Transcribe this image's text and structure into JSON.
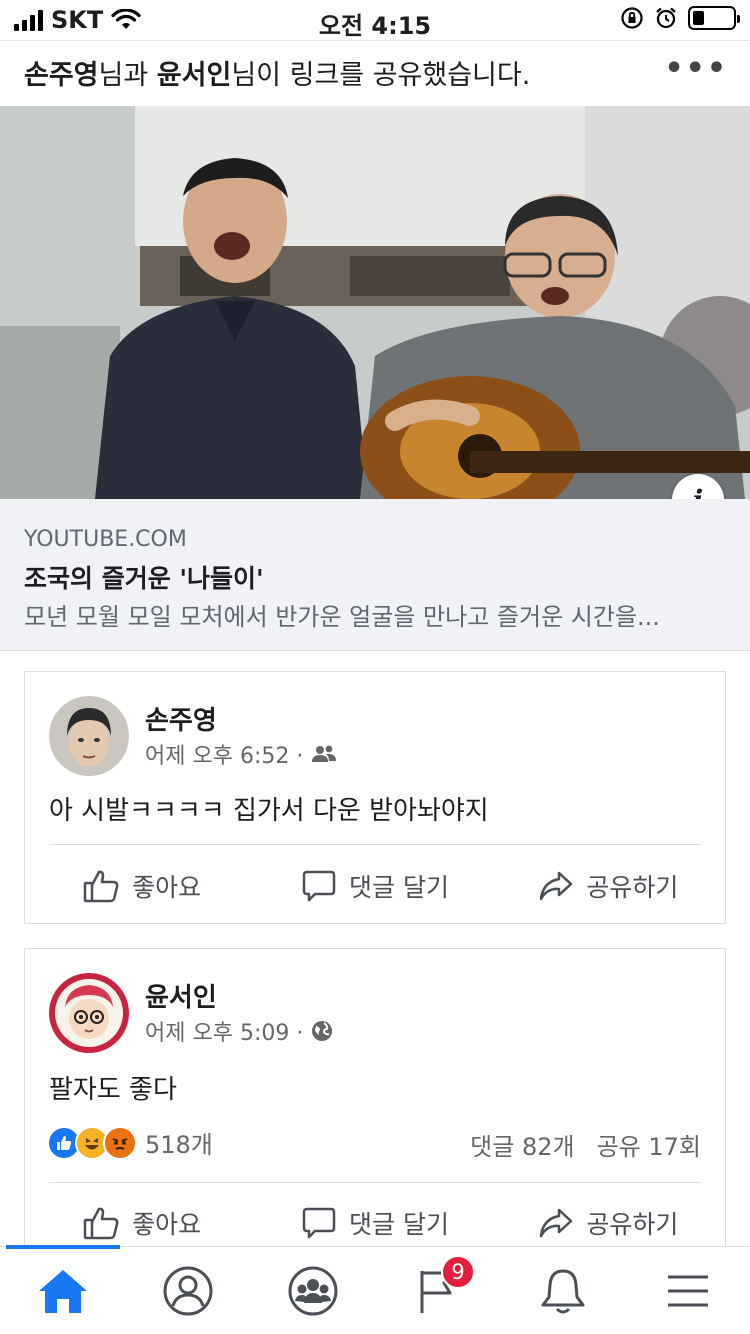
{
  "status_bar": {
    "carrier": "SKT",
    "time": "오전 4:15"
  },
  "share_header": {
    "user1": "손주영",
    "joiner": "님과 ",
    "user2": "윤서인",
    "suffix": "님이 링크를 공유했습니다.",
    "more_icon": "more-dots-icon"
  },
  "link_card": {
    "domain": "YOUTUBE.COM",
    "title": "조국의 즐거운 '나들이'",
    "description": "모년 모월 모일 모처에서 반가운 얼굴을 만나고 즐거운 시간을...",
    "info_label": "i"
  },
  "comment1": {
    "author": "손주영",
    "time": "어제 오후 6:52 ·",
    "privacy_icon": "friends-icon",
    "text": "아 시발ㅋㅋㅋㅋ 집가서 다운 받아놔야지",
    "actions": {
      "like": "좋아요",
      "comment": "댓글 달기",
      "share": "공유하기"
    }
  },
  "post2": {
    "author": "윤서인",
    "time": "어제 오후 5:09 ·",
    "privacy_icon": "globe-icon",
    "text": "팔자도 좋다",
    "reaction_count": "518개",
    "comments_count": "댓글 82개",
    "shares_count": "공유 17회",
    "actions": {
      "like": "좋아요",
      "comment": "댓글 달기",
      "share": "공유하기"
    }
  },
  "tab_bar": {
    "tabs": [
      "home",
      "profile",
      "groups",
      "pages",
      "notifications",
      "menu"
    ],
    "pages_badge": "9",
    "active_color": "#1877f2"
  },
  "colors": {
    "accent": "#1877f2",
    "badge": "#e41e3f",
    "secondary_text": "#65676b"
  }
}
